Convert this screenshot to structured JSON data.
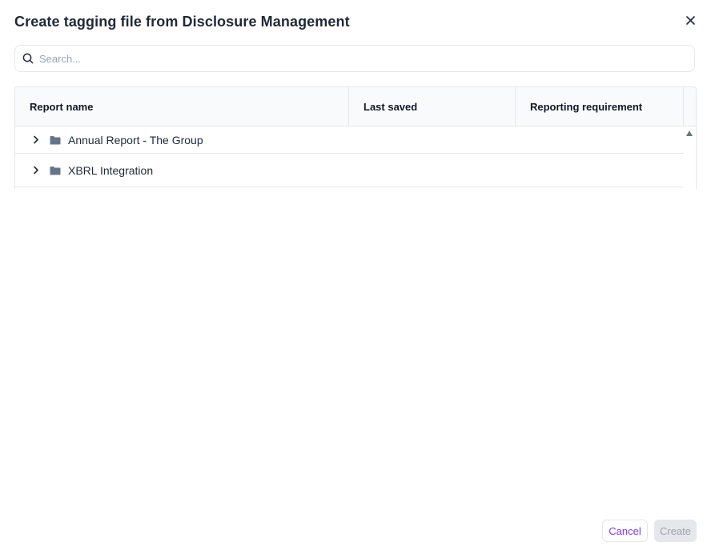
{
  "dialog": {
    "title": "Create tagging file from Disclosure Management",
    "close_icon": "close-icon"
  },
  "search": {
    "placeholder": "Search...",
    "value": "",
    "icon": "search-icon"
  },
  "table": {
    "columns": [
      "Report name",
      "Last saved",
      "Reporting requirement",
      ""
    ],
    "rows": [
      {
        "name": "Annual Report - The Group",
        "last_saved": "",
        "reporting_requirement": "",
        "icon": "folder-icon",
        "expander": "chevron-right-icon"
      },
      {
        "name": "XBRL Integration",
        "last_saved": "",
        "reporting_requirement": "",
        "icon": "folder-icon",
        "expander": "chevron-right-icon"
      }
    ]
  },
  "footer": {
    "cancel_label": "Cancel",
    "create_label": "Create",
    "create_disabled": true
  },
  "colors": {
    "accent": "#7c3aed",
    "folder": "#64748b",
    "border": "#e5e7eb",
    "header_bg": "#f9fafb"
  }
}
